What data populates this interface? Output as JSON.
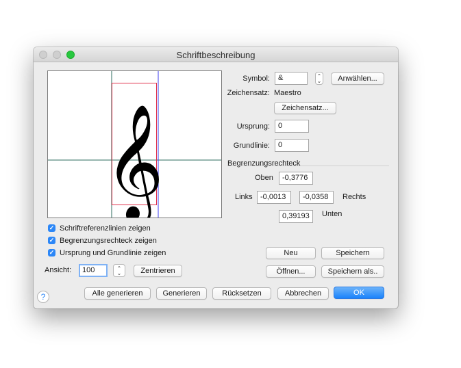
{
  "window": {
    "title": "Schriftbeschreibung"
  },
  "preview": {
    "glyph": "𝄞"
  },
  "symbol": {
    "label": "Symbol:",
    "value": "&",
    "select_button": "Anwählen..."
  },
  "charset": {
    "label": "Zeichensatz:",
    "value": "Maestro",
    "button": "Zeichensatz..."
  },
  "origin": {
    "label": "Ursprung:",
    "value": "0"
  },
  "baseline": {
    "label": "Grundlinie:",
    "value": "0"
  },
  "bounds": {
    "heading": "Begrenzungsrechteck",
    "top_label": "Oben",
    "top_value": "-0,3776",
    "left_label": "Links",
    "left_value": "-0,0013",
    "right_value": "-0,0358",
    "right_label": "Rechts",
    "bottom_value": "0,39193",
    "bottom_label": "Unten"
  },
  "checkboxes": [
    {
      "label": "Schriftreferenzlinien zeigen",
      "checked": true
    },
    {
      "label": "Begrenzungsrechteck zeigen",
      "checked": true
    },
    {
      "label": "Ursprung und Grundlinie zeigen",
      "checked": true
    }
  ],
  "view": {
    "label": "Ansicht:",
    "value": "100",
    "center_button": "Zentrieren"
  },
  "buttons": {
    "new": "Neu",
    "save": "Speichern",
    "open": "Öffnen...",
    "save_as": "Speichern als..",
    "generate_all": "Alle generieren",
    "generate": "Generieren",
    "reset": "Rücksetzen",
    "cancel": "Abbrechen",
    "ok": "OK",
    "help": "?"
  },
  "colors": {
    "accent": "#2c87f7",
    "close": "#ff5f57",
    "minimize": "#febc2e",
    "zoom": "#28c840"
  }
}
